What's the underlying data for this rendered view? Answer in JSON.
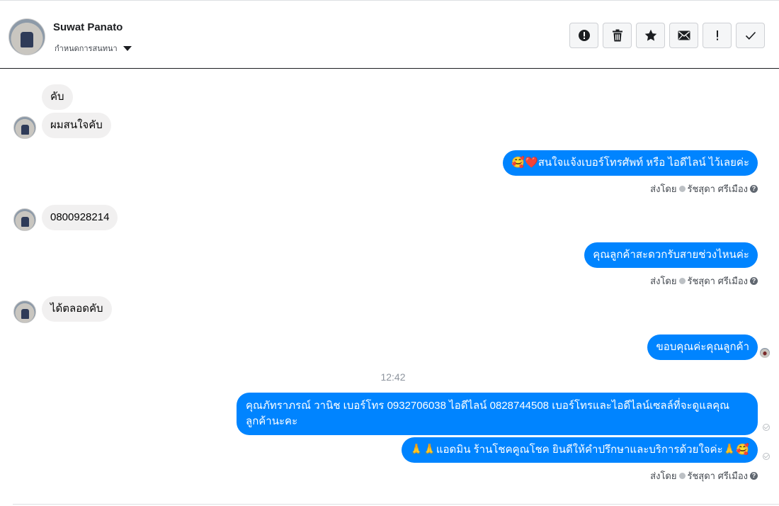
{
  "header": {
    "name": "Suwat Panato",
    "assign_label": "กำหนดการสนทนา"
  },
  "actions": [
    {
      "icon": "alert-circle-icon",
      "label": "Mark as spam"
    },
    {
      "icon": "trash-icon",
      "label": "Delete"
    },
    {
      "icon": "star-icon",
      "label": "Follow up"
    },
    {
      "icon": "envelope-icon",
      "label": "Mark as unread"
    },
    {
      "icon": "exclamation-icon",
      "label": "Mark as important"
    },
    {
      "icon": "check-icon",
      "label": "Mark as done"
    }
  ],
  "messages": {
    "m1": "คับ",
    "m2": "ผมสนใจคับ",
    "m3": "🥰❤️สนใจแจ้งเบอร์โทรศัพท์ หรือ ไอดีไลน์  ไว้เลยค่ะ",
    "m4": "0800928214",
    "m5": "คุณลูกค้าสะดวกรับสายช่วงไหนค่ะ",
    "m6": "ได้ตลอดคับ",
    "m7": "ขอบคุณค่ะคุณลูกค้า",
    "time": "12:42",
    "m8": "คุณภัทราภรณ์  วานิช      เบอร์โทร 0932706038  ไอดีไลน์ 0828744508   เบอร์โทรและไอดีไลน์เซลล์ที่จะดูแลคุณลูกค้านะคะ",
    "m9": "🙏🙏แอดมิน ร้านโชคคูณโชค ยินดีให้คำปรึกษาและบริการด้วยใจค่ะ🙏🥰"
  },
  "sent_by": {
    "prefix": "ส่งโดย",
    "name": "รัชสุดา ศรีเมือง"
  },
  "colors": {
    "outgoing": "#0084ff",
    "incoming": "#f1f0f0"
  }
}
